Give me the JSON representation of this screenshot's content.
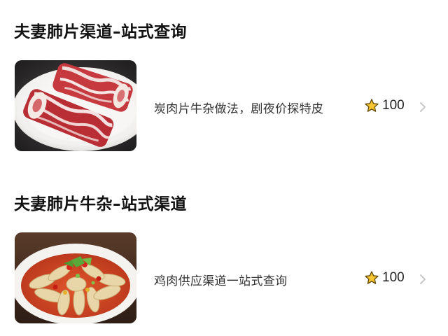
{
  "sections": [
    {
      "title": "夫妻肺片渠道–站式查询",
      "item": {
        "image": "sliced-beef-plate",
        "description": "炭肉片牛杂做法，剧夜价探特皮",
        "rating_icon": "star-icon",
        "rating": "100"
      }
    },
    {
      "title": "夫妻肺片牛杂–站式渠道",
      "item": {
        "image": "chili-chicken-feet-bowl",
        "description": "鸡肉供应渠道一站式查询",
        "rating_icon": "star-icon",
        "rating": "100"
      }
    }
  ],
  "colors": {
    "star_fill": "#f7c531",
    "star_stroke": "#5a4300",
    "chevron": "#c8c8c8"
  }
}
